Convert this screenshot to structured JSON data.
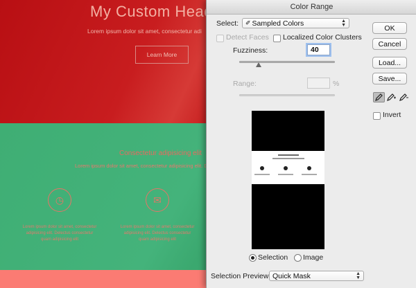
{
  "website": {
    "hero_title": "My Custom Head",
    "hero_subtitle": "Lorem ipsum dolor sit amet, consectetur adi",
    "hero_button": "Learn More",
    "section_title": "Consectetur adipisicing elit",
    "section_subtitle": "Lorem ipsum dolor sit amet, consectetur adipisicing elit. Delectus cons",
    "col1_text": "Lorem ipsum dolor sit amet, consectetur adipisicing elit. Delectus consectetur quam adipisicing elit",
    "col2_text": "Lorem ipsum dolor sit amet, consectetur adipisicing elit. Delectus consectetur quam adipisicing elit"
  },
  "dialog": {
    "title": "Color Range",
    "select_label": "Select:",
    "select_value": "Sampled Colors",
    "detect_faces": "Detect Faces",
    "localized_clusters": "Localized Color Clusters",
    "fuzziness_label": "Fuzziness:",
    "fuzziness_value": "40",
    "range_label": "Range:",
    "range_value": "",
    "range_unit": "%",
    "selection_radio": "Selection",
    "image_radio": "Image",
    "preview_label": "Selection Preview:",
    "preview_value": "Quick Mask",
    "buttons": {
      "ok": "OK",
      "cancel": "Cancel",
      "load": "Load...",
      "save": "Save..."
    },
    "invert_label": "Invert",
    "fuzziness_level": 0.2
  },
  "colors": {
    "hero_red": "#c01416",
    "green": "#42b078",
    "coral": "#fb7b73",
    "dialog_bg": "#ececec"
  }
}
